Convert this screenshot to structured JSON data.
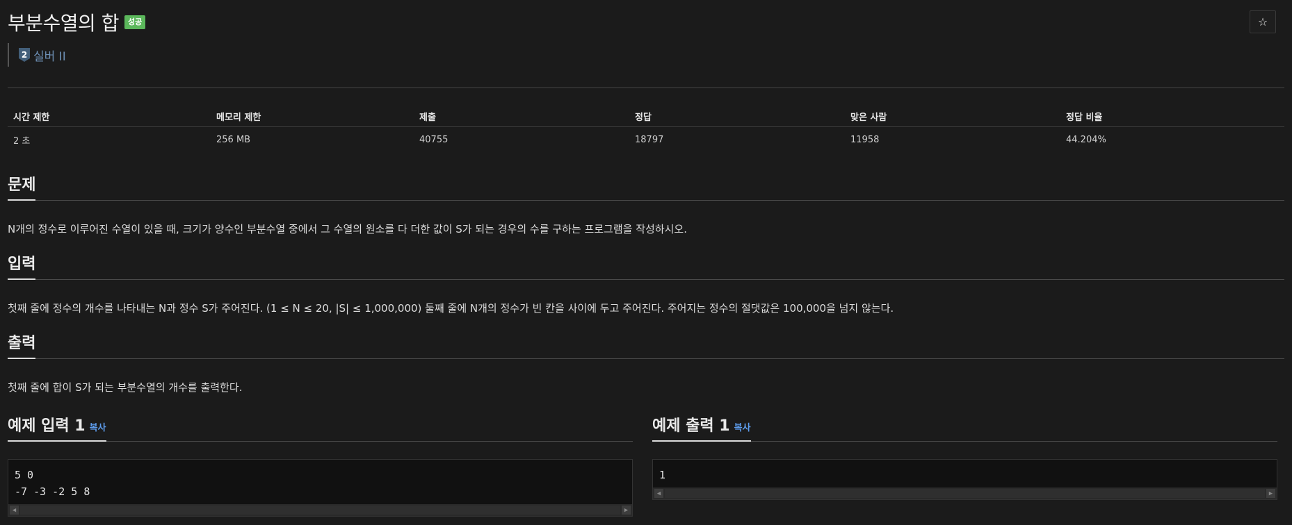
{
  "problem": {
    "title": "부분수열의 합",
    "status_badge": "성공",
    "tier_number": "2",
    "tier_label": "실버 II",
    "star_icon": "☆"
  },
  "stats": {
    "headers": [
      "시간 제한",
      "메모리 제한",
      "제출",
      "정답",
      "맞은 사람",
      "정답 비율"
    ],
    "values": [
      "2 초",
      "256 MB",
      "40755",
      "18797",
      "11958",
      "44.204%"
    ]
  },
  "sections": {
    "problem": {
      "title": "문제",
      "text": "N개의 정수로 이루어진 수열이 있을 때, 크기가 양수인 부분수열 중에서 그 수열의 원소를 다 더한 값이 S가 되는 경우의 수를 구하는 프로그램을 작성하시오."
    },
    "input": {
      "title": "입력",
      "text": "첫째 줄에 정수의 개수를 나타내는 N과 정수 S가 주어진다. (1 ≤ N ≤ 20, |S| ≤ 1,000,000) 둘째 줄에 N개의 정수가 빈 칸을 사이에 두고 주어진다. 주어지는 정수의 절댓값은 100,000을 넘지 않는다."
    },
    "output": {
      "title": "출력",
      "text": "첫째 줄에 합이 S가 되는 부분수열의 개수를 출력한다."
    }
  },
  "examples": {
    "input": {
      "title": "예제 입력 1",
      "copy_label": "복사",
      "code": "5 0\n-7 -3 -2 5 8"
    },
    "output": {
      "title": "예제 출력 1",
      "copy_label": "복사",
      "code": "1"
    }
  },
  "icons": {
    "scroll_left": "◀",
    "scroll_right": "▶"
  },
  "colors": {
    "background": "#1b1b1b",
    "success_badge": "#5cb85c",
    "tier_text": "#6d8fb4",
    "link": "#5d9cec"
  }
}
